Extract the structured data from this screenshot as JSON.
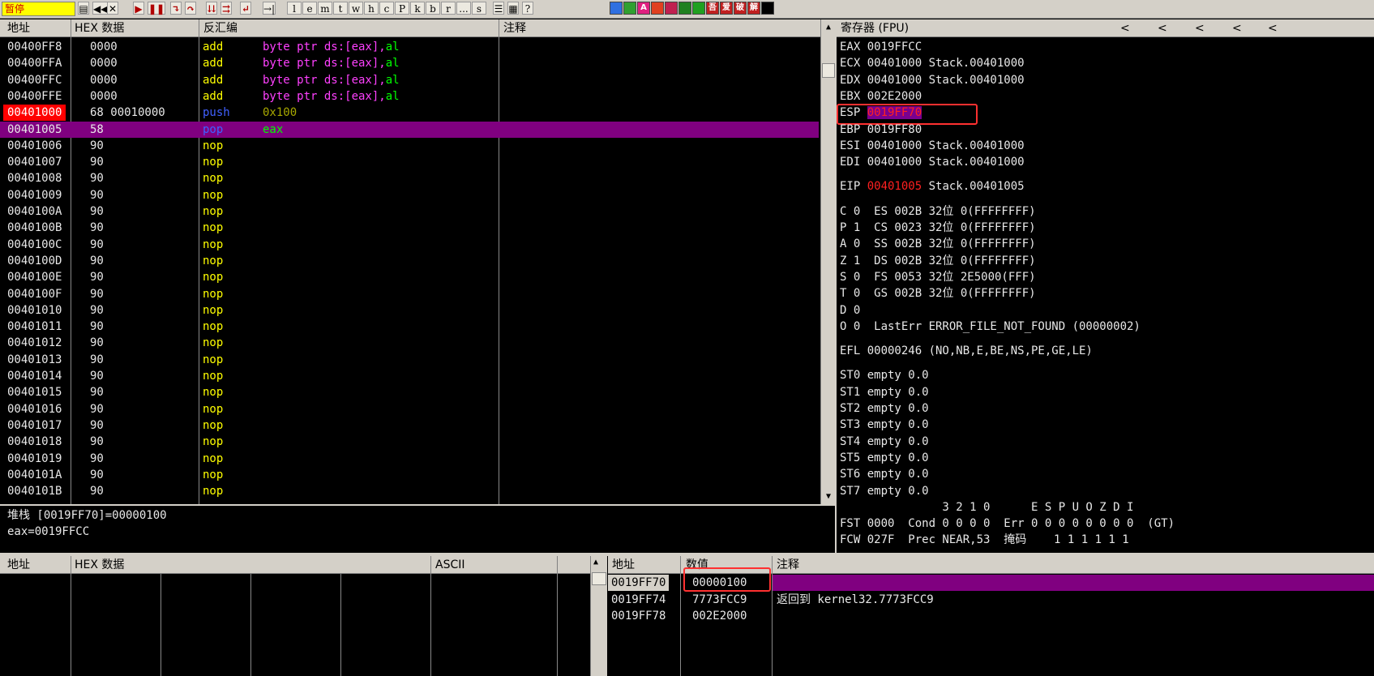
{
  "toolbar": {
    "status": "暂停",
    "letters": [
      "l",
      "e",
      "m",
      "t",
      "w",
      "h",
      "c",
      "P",
      "k",
      "b",
      "r",
      "...",
      "s"
    ],
    "color_icons": [
      {
        "label": "",
        "color": "#3070e0"
      },
      {
        "label": "",
        "color": "#30a030"
      },
      {
        "label": "A",
        "color": "#e02080"
      },
      {
        "label": "",
        "color": "#e04020"
      },
      {
        "label": "",
        "color": "#c02050"
      },
      {
        "label": "",
        "color": "#208020"
      },
      {
        "label": "",
        "color": "#20a020"
      },
      {
        "label": "吾",
        "color": "#c02020"
      },
      {
        "label": "爱",
        "color": "#c02020"
      },
      {
        "label": "破",
        "color": "#c02020"
      },
      {
        "label": "解",
        "color": "#c02020"
      },
      {
        "label": "",
        "color": "#000000"
      }
    ]
  },
  "disasm": {
    "headers": {
      "address": "地址",
      "hex": "HEX 数据",
      "disasm": "反汇编",
      "comment": "注释"
    },
    "rows": [
      {
        "addr": "00400FF8",
        "hex": "0000",
        "mn": "add",
        "op": [
          [
            "byte ptr ds:[eax],",
            "mag"
          ],
          [
            "al",
            "green"
          ]
        ]
      },
      {
        "addr": "00400FFA",
        "hex": "0000",
        "mn": "add",
        "op": [
          [
            "byte ptr ds:[eax],",
            "mag"
          ],
          [
            "al",
            "green"
          ]
        ]
      },
      {
        "addr": "00400FFC",
        "hex": "0000",
        "mn": "add",
        "op": [
          [
            "byte ptr ds:[eax],",
            "mag"
          ],
          [
            "al",
            "green"
          ]
        ]
      },
      {
        "addr": "00400FFE",
        "hex": "0000",
        "mn": "add",
        "op": [
          [
            "byte ptr ds:[eax],",
            "mag"
          ],
          [
            "al",
            "green"
          ]
        ]
      },
      {
        "addr": "00401000",
        "hex": "68 00010000",
        "mn": "push",
        "op": [
          [
            "0x100",
            "olive"
          ]
        ],
        "breakpoint": true
      },
      {
        "addr": "00401005",
        "hex": "58",
        "mn": "pop",
        "op": [
          [
            "eax",
            "green"
          ]
        ],
        "current": true
      },
      {
        "addr": "00401006",
        "hex": "90",
        "mn": "nop",
        "op": []
      },
      {
        "addr": "00401007",
        "hex": "90",
        "mn": "nop",
        "op": []
      },
      {
        "addr": "00401008",
        "hex": "90",
        "mn": "nop",
        "op": []
      },
      {
        "addr": "00401009",
        "hex": "90",
        "mn": "nop",
        "op": []
      },
      {
        "addr": "0040100A",
        "hex": "90",
        "mn": "nop",
        "op": []
      },
      {
        "addr": "0040100B",
        "hex": "90",
        "mn": "nop",
        "op": []
      },
      {
        "addr": "0040100C",
        "hex": "90",
        "mn": "nop",
        "op": []
      },
      {
        "addr": "0040100D",
        "hex": "90",
        "mn": "nop",
        "op": []
      },
      {
        "addr": "0040100E",
        "hex": "90",
        "mn": "nop",
        "op": []
      },
      {
        "addr": "0040100F",
        "hex": "90",
        "mn": "nop",
        "op": []
      },
      {
        "addr": "00401010",
        "hex": "90",
        "mn": "nop",
        "op": []
      },
      {
        "addr": "00401011",
        "hex": "90",
        "mn": "nop",
        "op": []
      },
      {
        "addr": "00401012",
        "hex": "90",
        "mn": "nop",
        "op": []
      },
      {
        "addr": "00401013",
        "hex": "90",
        "mn": "nop",
        "op": []
      },
      {
        "addr": "00401014",
        "hex": "90",
        "mn": "nop",
        "op": []
      },
      {
        "addr": "00401015",
        "hex": "90",
        "mn": "nop",
        "op": []
      },
      {
        "addr": "00401016",
        "hex": "90",
        "mn": "nop",
        "op": []
      },
      {
        "addr": "00401017",
        "hex": "90",
        "mn": "nop",
        "op": []
      },
      {
        "addr": "00401018",
        "hex": "90",
        "mn": "nop",
        "op": []
      },
      {
        "addr": "00401019",
        "hex": "90",
        "mn": "nop",
        "op": []
      },
      {
        "addr": "0040101A",
        "hex": "90",
        "mn": "nop",
        "op": []
      },
      {
        "addr": "0040101B",
        "hex": "90",
        "mn": "nop",
        "op": []
      }
    ]
  },
  "info": {
    "line1": "堆栈 [0019FF70]=00000100",
    "line2": "eax=0019FFCC"
  },
  "registers": {
    "header": "寄存器 (FPU)",
    "arrows": [
      "<",
      "<",
      "<",
      "<",
      "<"
    ],
    "lines": [
      {
        "text": "EAX 0019FFCC"
      },
      {
        "text": "ECX 00401000 Stack.00401000"
      },
      {
        "text": "EDX 00401000 Stack.00401000"
      },
      {
        "text": "EBX 002E2000"
      },
      {
        "label": "ESP ",
        "value": "0019FF70",
        "style": "esp"
      },
      {
        "text": "EBP 0019FF80"
      },
      {
        "text": "ESI 00401000 Stack.00401000"
      },
      {
        "text": "EDI 00401000 Stack.00401000"
      },
      {
        "gap": true
      },
      {
        "label": "EIP ",
        "value": "00401005",
        "rest": " Stack.00401005",
        "style": "red"
      },
      {
        "gap": true
      },
      {
        "text": "C 0  ES 002B 32位 0(FFFFFFFF)"
      },
      {
        "text": "P 1  CS 0023 32位 0(FFFFFFFF)"
      },
      {
        "text": "A 0  SS 002B 32位 0(FFFFFFFF)"
      },
      {
        "text": "Z 1  DS 002B 32位 0(FFFFFFFF)"
      },
      {
        "text": "S 0  FS 0053 32位 2E5000(FFF)"
      },
      {
        "text": "T 0  GS 002B 32位 0(FFFFFFFF)"
      },
      {
        "text": "D 0"
      },
      {
        "text": "O 0  LastErr ERROR_FILE_NOT_FOUND (00000002)"
      },
      {
        "gap": true
      },
      {
        "text": "EFL 00000246 (NO,NB,E,BE,NS,PE,GE,LE)"
      },
      {
        "gap": true
      },
      {
        "text": "ST0 empty 0.0"
      },
      {
        "text": "ST1 empty 0.0"
      },
      {
        "text": "ST2 empty 0.0"
      },
      {
        "text": "ST3 empty 0.0"
      },
      {
        "text": "ST4 empty 0.0"
      },
      {
        "text": "ST5 empty 0.0"
      },
      {
        "text": "ST6 empty 0.0"
      },
      {
        "text": "ST7 empty 0.0"
      },
      {
        "text": "               3 2 1 0      E S P U O Z D I"
      },
      {
        "text": "FST 0000  Cond 0 0 0 0  Err 0 0 0 0 0 0 0 0  (GT)"
      },
      {
        "text": "FCW 027F  Prec NEAR,53  掩码    1 1 1 1 1 1"
      }
    ]
  },
  "dump": {
    "headers": {
      "address": "地址",
      "hex": "HEX 数据",
      "ascii": "ASCII"
    }
  },
  "stack": {
    "headers": {
      "address": "地址",
      "value": "数值",
      "comment": "注释"
    },
    "rows": [
      {
        "addr": "0019FF70",
        "value": "00000100",
        "comment": "",
        "current": true
      },
      {
        "addr": "0019FF74",
        "value": "7773FCC9",
        "comment": "返回到 kernel32.7773FCC9"
      },
      {
        "addr": "0019FF78",
        "value": "002E2000",
        "comment": ""
      }
    ]
  }
}
